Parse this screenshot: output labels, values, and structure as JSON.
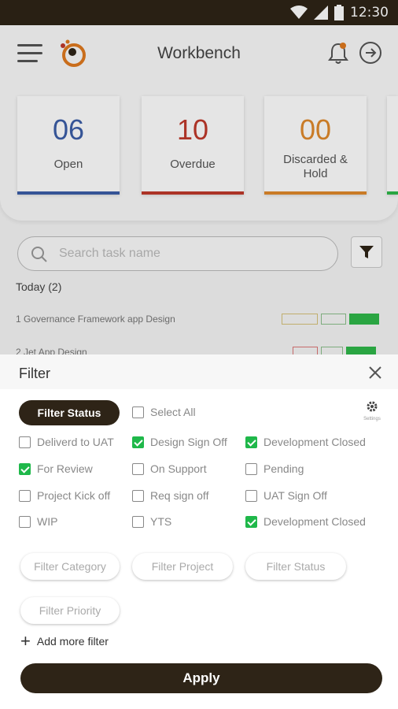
{
  "status_bar": {
    "time": "12:30"
  },
  "app_bar": {
    "title": "Workbench"
  },
  "stats": [
    {
      "value": "06",
      "label": "Open",
      "color": "#3b5ea8"
    },
    {
      "value": "10",
      "label": "Overdue",
      "color": "#c0392b"
    },
    {
      "value": "00",
      "label": "Discarded & Hold",
      "color": "#e08a2c"
    }
  ],
  "search": {
    "placeholder": "Search task name"
  },
  "today_label": "Today (2)",
  "tasks": [
    {
      "text": "1 Governance Framework app Design"
    },
    {
      "text": "2 Jet App Design"
    }
  ],
  "filter": {
    "title": "Filter",
    "status_chip": "Filter Status",
    "select_all": "Select All",
    "settings_label": "Settings",
    "options": [
      {
        "label": "Deliverd to UAT",
        "checked": false
      },
      {
        "label": "Design Sign Off",
        "checked": true
      },
      {
        "label": "Development Closed",
        "checked": true
      },
      {
        "label": "For Review",
        "checked": true
      },
      {
        "label": "On Support",
        "checked": false
      },
      {
        "label": "Pending",
        "checked": false
      },
      {
        "label": "Project Kick off",
        "checked": false
      },
      {
        "label": "Req sign off",
        "checked": false
      },
      {
        "label": "UAT Sign Off",
        "checked": false
      },
      {
        "label": "WIP",
        "checked": false
      },
      {
        "label": "YTS",
        "checked": false
      },
      {
        "label": "Development Closed",
        "checked": true
      }
    ],
    "pills": [
      "Filter Category",
      "Filter Project",
      "Filter Status",
      "Filter Priority"
    ],
    "add_more": "Add more filter",
    "apply": "Apply"
  },
  "colors": {
    "dark": "#2e2417",
    "check": "#1fb84a"
  }
}
